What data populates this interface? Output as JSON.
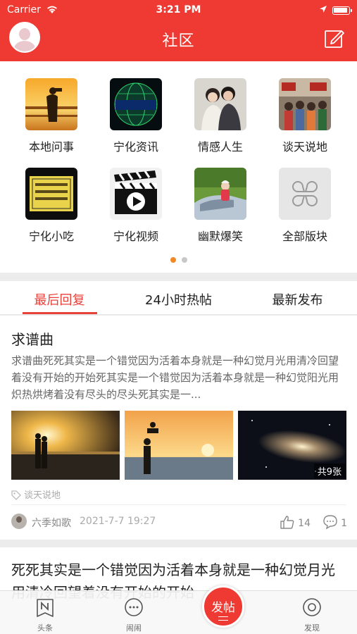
{
  "status_bar": {
    "carrier": "Carrier",
    "time": "3:21 PM"
  },
  "header": {
    "title": "社区",
    "compose_icon": "compose-icon",
    "avatar_icon": "avatar"
  },
  "categories": [
    {
      "label": "本地问事"
    },
    {
      "label": "宁化资讯"
    },
    {
      "label": "情感人生"
    },
    {
      "label": "谈天说地"
    },
    {
      "label": "宁化小吃"
    },
    {
      "label": "宁化视频"
    },
    {
      "label": "幽默爆笑"
    },
    {
      "label": "全部版块"
    }
  ],
  "pager": {
    "pages": 2,
    "current": 1
  },
  "tabs": [
    {
      "label": "最后回复",
      "active": true
    },
    {
      "label": "24小时热帖",
      "active": false
    },
    {
      "label": "最新发布",
      "active": false
    }
  ],
  "posts": [
    {
      "title": "求谱曲",
      "body": "求谱曲死死其实是一个错觉因为活着本身就是一种幻觉月光用清冷回望着没有开始的开始死其实是一个错觉因为活着本身就是一种幻觉阳光用炽热烘烤着没有尽头的尽头死其实是一...",
      "images_count": "共9张",
      "tag": "谈天说地",
      "author": "六季如歌",
      "date": "2021-7-7 19:27",
      "likes": "14",
      "comments": "1"
    },
    {
      "title": "死死其实是一个错觉因为活着本身就是一种幻觉月光用清冷回望着没有开始的开始"
    }
  ],
  "tabbar": {
    "items": [
      {
        "label": "头条",
        "icon": "headline-icon"
      },
      {
        "label": "闹闹",
        "icon": "chat-bubble-icon"
      },
      {
        "label": "发现",
        "icon": "discover-icon"
      }
    ],
    "post_button": "发帖"
  },
  "colors": {
    "accent": "#ee3a32",
    "active_tab": "#e8413a",
    "pager_active": "#f08a24"
  }
}
